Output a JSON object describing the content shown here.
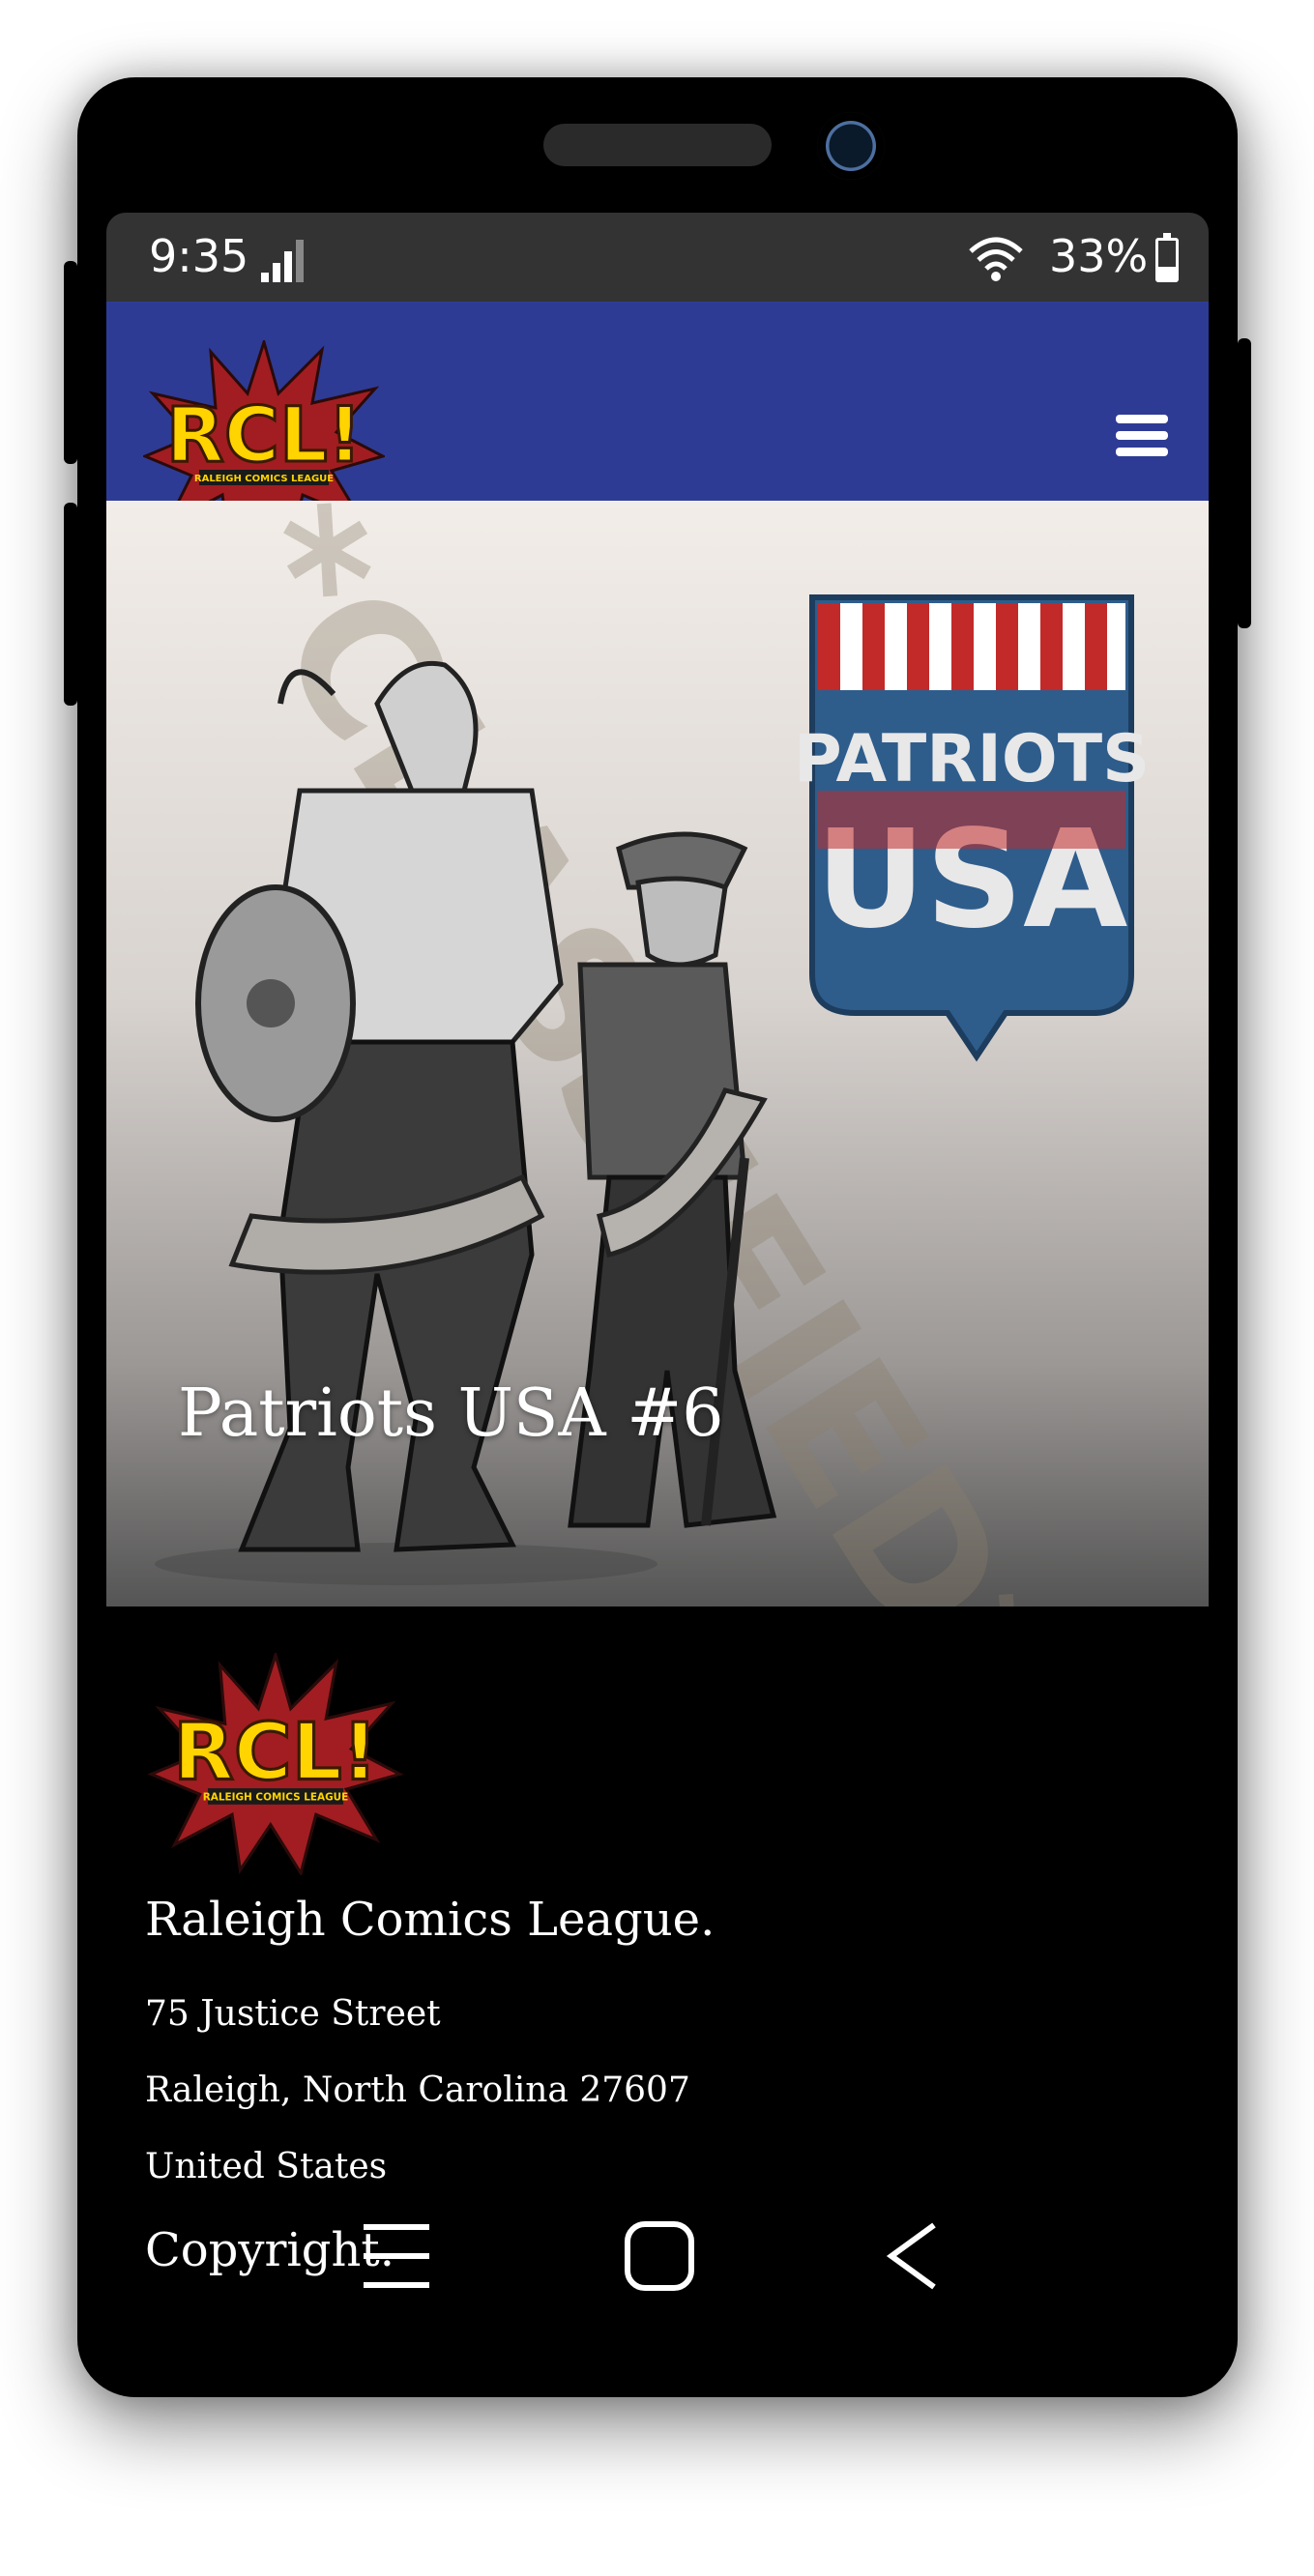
{
  "status_bar": {
    "time": "9:35",
    "battery_percent": "33%",
    "battery_level": 0.33
  },
  "header": {
    "logo_text": "RCL!",
    "logo_subtext": "RALEIGH COMICS LEAGUE",
    "menu_icon": "hamburger-menu-icon",
    "brand_color": "#2e3b94"
  },
  "hero": {
    "title": "Patriots USA #6",
    "badge_line1": "PATRIOTS",
    "badge_line2": "USA",
    "watermark": "*CLASSIFIED*"
  },
  "footer": {
    "logo_text": "RCL!",
    "logo_subtext": "RALEIGH COMICS LEAGUE",
    "org_name": "Raleigh Comics League.",
    "address_line1": "75 Justice Street",
    "address_line2": "Raleigh, North Carolina 27607",
    "address_line3": "United States",
    "copyright": "Copyright."
  },
  "nav_bar": {
    "recent_icon": "recent-apps-icon",
    "home_icon": "home-icon",
    "back_icon": "back-icon"
  }
}
